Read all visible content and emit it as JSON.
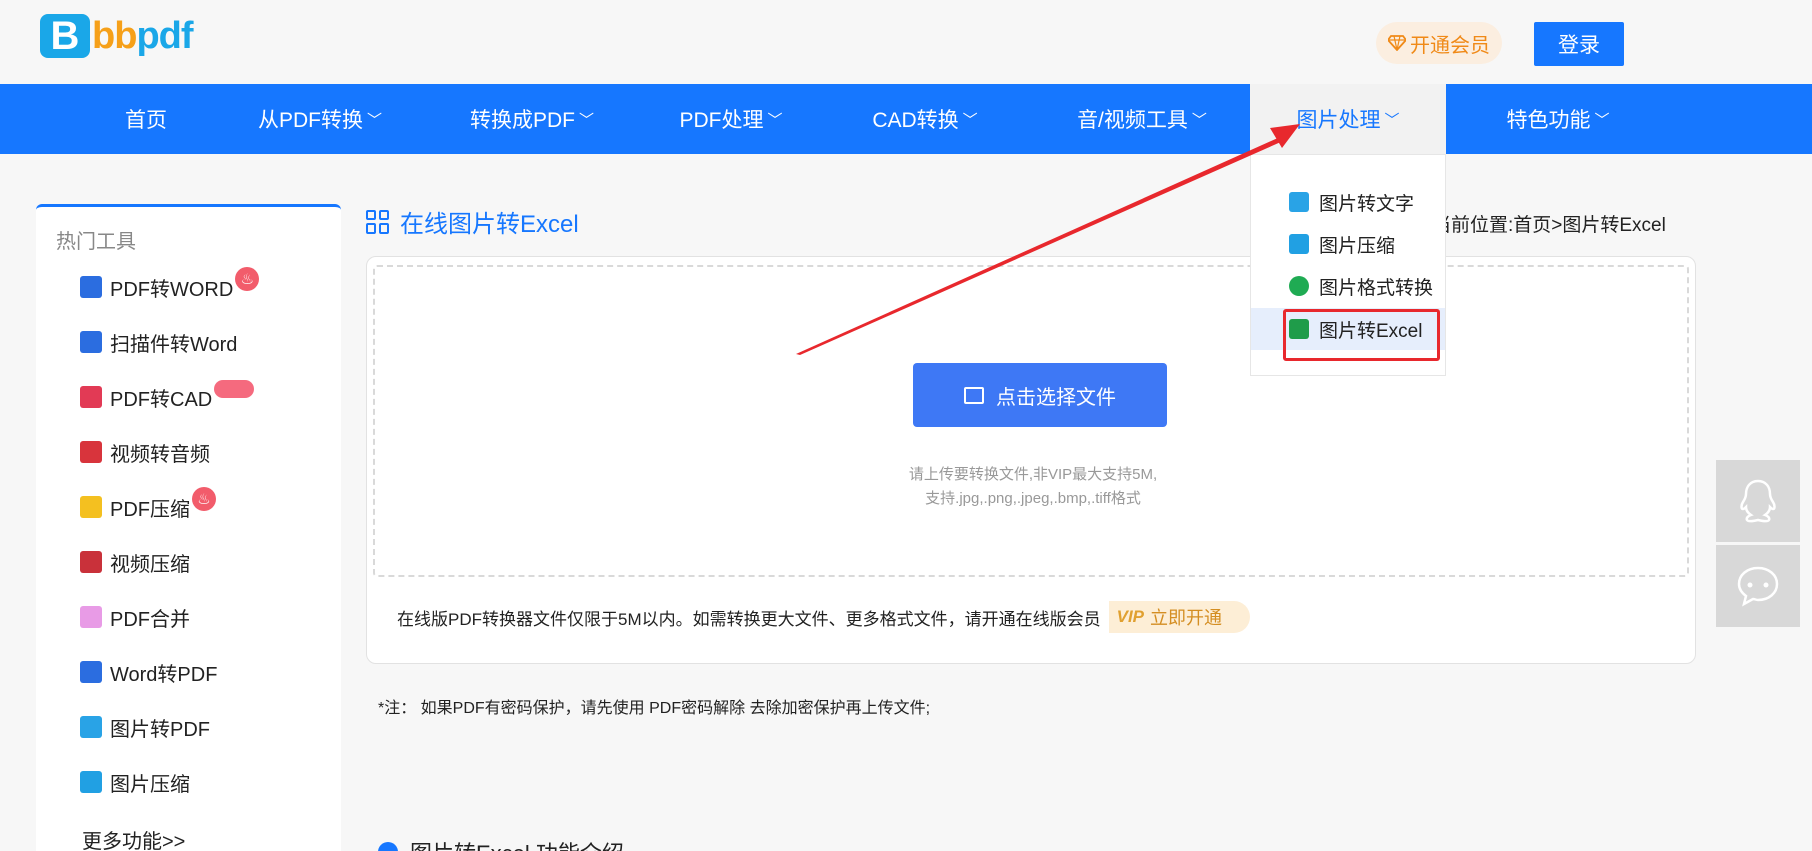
{
  "header": {
    "logo_letter": "B",
    "logo_text_a": "bb",
    "logo_text_b": "pdf",
    "vip_label": "开通会员",
    "login_label": "登录"
  },
  "nav": {
    "items": [
      {
        "label": "首页",
        "chevron": ""
      },
      {
        "label": "从PDF转换",
        "chevron": "﹀"
      },
      {
        "label": "转换成PDF",
        "chevron": "﹀"
      },
      {
        "label": "PDF处理",
        "chevron": "﹀"
      },
      {
        "label": "CAD转换",
        "chevron": "﹀"
      },
      {
        "label": "音/视频工具",
        "chevron": "﹀"
      },
      {
        "label": "图片处理",
        "chevron": "﹀"
      },
      {
        "label": "特色功能",
        "chevron": "﹀"
      }
    ]
  },
  "dropdown": {
    "items": [
      {
        "label": "图片转文字",
        "color": "#29a3e6"
      },
      {
        "label": "图片压缩",
        "color": "#21a0e3"
      },
      {
        "label": "图片格式转换",
        "color": "#1fab53"
      },
      {
        "label": "图片转Excel",
        "color": "#1f9c4a"
      }
    ]
  },
  "sidebar": {
    "title": "热门工具",
    "items": [
      {
        "label": "PDF转WORD",
        "color": "#2b6de0"
      },
      {
        "label": "扫描件转Word",
        "color": "#2b6de0"
      },
      {
        "label": "PDF转CAD",
        "color": "#e23a55"
      },
      {
        "label": "视频转音频",
        "color": "#d8343c"
      },
      {
        "label": "PDF压缩",
        "color": "#f4c020"
      },
      {
        "label": "视频压缩",
        "color": "#c9313a"
      },
      {
        "label": "PDF合并",
        "color": "#e89be6"
      },
      {
        "label": "Word转PDF",
        "color": "#2b6de0"
      },
      {
        "label": "图片转PDF",
        "color": "#29a3e6"
      },
      {
        "label": "图片压缩",
        "color": "#21a0e3"
      }
    ],
    "more_label": "更多功能>>"
  },
  "main": {
    "title": "在线图片转Excel",
    "breadcrumb": "当前位置:首页>图片转Excel",
    "select_button": "点击选择文件",
    "hint_line1": "请上传要转换文件,非VIP最大支持5M,",
    "hint_line2": "支持.jpg,.png,.jpeg,.bmp,.tiff格式",
    "notice": "在线版PDF转换器文件仅限于5M以内。如需转换更大文件、更多格式文件，请开通在线版会员",
    "open_vip_badge": "VIP",
    "open_vip_label": "立即开通",
    "note": "*注：  如果PDF有密码保护，请先使用 PDF密码解除 去除加密保护再上传文件;",
    "section_title": "图片转Excel 功能介绍"
  },
  "colors": {
    "primary": "#1677ff",
    "button": "#3e78f5",
    "highlight": "#e8282d"
  }
}
